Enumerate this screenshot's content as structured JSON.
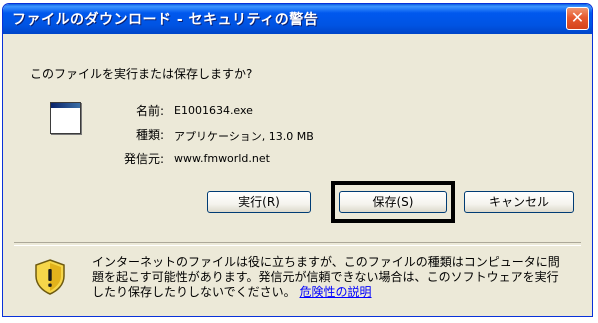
{
  "window": {
    "title": "ファイルのダウンロード - セキュリティの警告",
    "close_glyph": "✕"
  },
  "prompt": {
    "question": "このファイルを実行または保存しますか?"
  },
  "file_info": {
    "name_label": "名前:",
    "name_value": "E1001634.exe",
    "type_label": "種類:",
    "type_value": "アプリケーション, 13.0 MB",
    "from_label": "発信元:",
    "from_value": "www.fmworld.net",
    "icon": "application-window-icon"
  },
  "buttons": {
    "run": "実行(R)",
    "save": "保存(S)",
    "cancel": "キャンセル"
  },
  "warning": {
    "icon": "security-shield-icon",
    "text": "インターネットのファイルは役に立ちますが、このファイルの種類はコンピュータに問題を起こす可能性があります。発信元が信頼できない場合は、このソフトウェアを実行したり保存したりしないでください。",
    "link": "危険性の説明"
  }
}
